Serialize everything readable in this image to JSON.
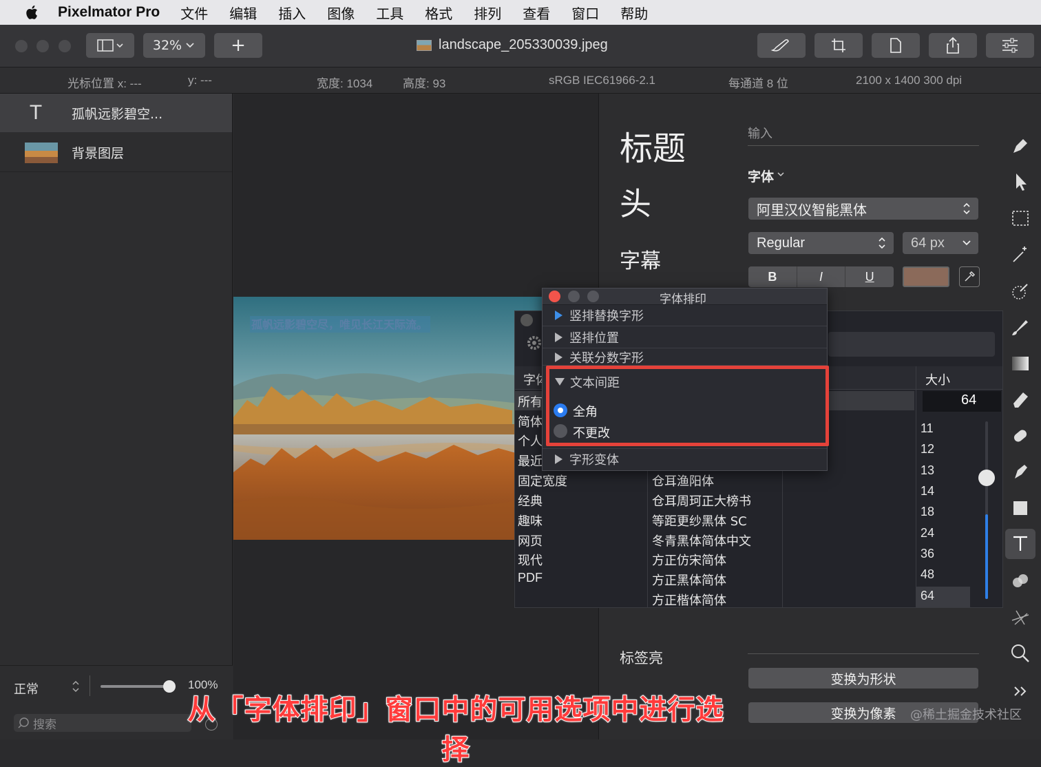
{
  "menubar": {
    "app": "Pixelmator Pro",
    "items": [
      "文件",
      "编辑",
      "插入",
      "图像",
      "工具",
      "格式",
      "排列",
      "查看",
      "窗口",
      "帮助"
    ]
  },
  "toolbar": {
    "zoom": "32%",
    "add": "+",
    "filename": "landscape_205330039.jpeg"
  },
  "infobar": {
    "cursor_x": "光标位置 x:  ---",
    "cursor_y": "y:  ---",
    "width": "宽度:  1034",
    "height": "高度:  93",
    "profile": "sRGB IEC61966-2.1",
    "depth": "每通道 8 位",
    "size": "2100 x 1400 300 dpi"
  },
  "layers": {
    "items": [
      "孤帆远影碧空...",
      "背景图层"
    ],
    "blend_mode": "正常",
    "opacity": "100%",
    "search_placeholder": "搜索",
    "opacity_value": 1.0
  },
  "photo": {
    "overlay_text": "孤帆远影碧空尽，唯见长江天际流。"
  },
  "inspector": {
    "presets": [
      "标题",
      "头",
      "字幕"
    ],
    "input_placeholder": "输入",
    "font_label": "字体",
    "font_name": "阿里汉仪智能黑体",
    "style": "Regular",
    "size": "64 px",
    "bold": "B",
    "italic": "I",
    "underline": "U",
    "color": "#8b6a5a",
    "tag_label": "标签亮",
    "convert_shape": "变换为形状",
    "convert_pixels": "变换为像素"
  },
  "fontpanel": {
    "col_family_header": "字体",
    "col_size_header": "大小",
    "size_value": "64",
    "categories": [
      "所有",
      "简体",
      "个人",
      "最近",
      "固定宽度",
      "经典",
      "趣味",
      "网页",
      "现代",
      "PDF"
    ],
    "families": [
      "仓耳渔阳体",
      "仓耳周珂正大榜书",
      "等距更纱黑体 SC",
      "冬青黑体简体中文",
      "方正仿宋简体",
      "方正黑体简体",
      "方正楷体简体"
    ],
    "sizes": [
      "11",
      "12",
      "13",
      "14",
      "18",
      "24",
      "36",
      "48",
      "64"
    ],
    "slider_fraction": 0.64
  },
  "typography": {
    "title": "字体排印",
    "sections": [
      "竖排替换字形",
      "竖排位置",
      "关联分数字形",
      "文本间距",
      "字形变体"
    ],
    "options": [
      "全角",
      "不更改"
    ],
    "selected_option": "全角",
    "highlight_color": "#e5423a"
  },
  "caption": "从「字体排印」窗口中的可用选项中进行选择",
  "watermark": "@稀土掘金技术社区"
}
